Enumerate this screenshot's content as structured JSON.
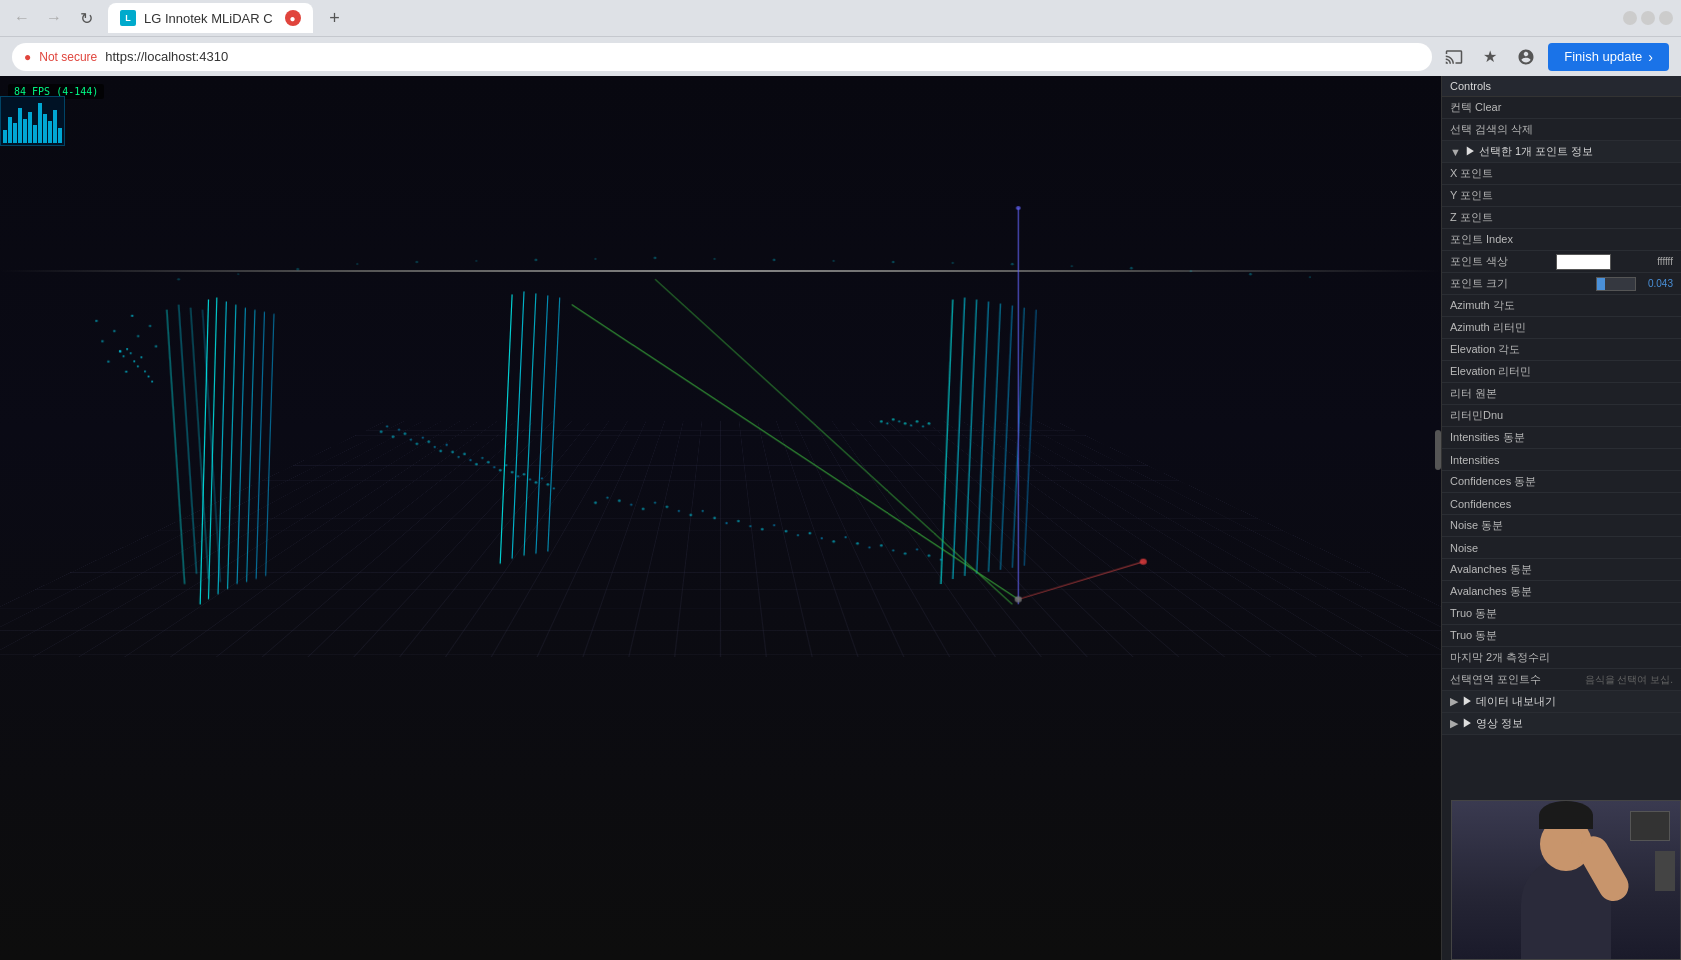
{
  "browser": {
    "tab_title": "LG Innotek MLiDAR C",
    "tab_favicon": "L",
    "new_tab_label": "+",
    "back_disabled": true,
    "forward_disabled": true,
    "refresh_label": "↻",
    "security_label": "Not secure",
    "address": "https://localhost:4310",
    "finish_update_label": "Finish update",
    "window_title": "LG Innotek MLiDAR C",
    "min_btn": "−",
    "max_btn": "□",
    "close_btn": "✕"
  },
  "viewport": {
    "fps_label": "84 FPS (4-144)",
    "waveform_label": "waveform"
  },
  "controls_panel": {
    "title": "Controls",
    "top_buttons": {
      "btn1_label": "컨텍 Clear",
      "btn2_label": "선택 검색의 삭제"
    },
    "selected_point_section": "▶ 선택한 1개 포인트 정보",
    "fields": [
      {
        "label": "X 포인트",
        "value": ""
      },
      {
        "label": "Y 포인트",
        "value": ""
      },
      {
        "label": "Z 포인트",
        "value": ""
      },
      {
        "label": "포인트 Index",
        "value": ""
      },
      {
        "label": "포인트 색상",
        "value": "ffffff",
        "type": "color"
      },
      {
        "label": "포인트 크기",
        "value": "0.043",
        "type": "size"
      },
      {
        "label": "Azimuth 각도",
        "value": ""
      },
      {
        "label": "Azimuth 리터민",
        "value": ""
      },
      {
        "label": "Elevation 각도",
        "value": ""
      },
      {
        "label": "Elevation 리터민",
        "value": ""
      },
      {
        "label": "리터 원본",
        "value": ""
      },
      {
        "label": "리터민Dnu",
        "value": ""
      },
      {
        "label": "Intensities 동분",
        "value": ""
      },
      {
        "label": "Intensities",
        "value": ""
      },
      {
        "label": "Confidences 동분",
        "value": ""
      },
      {
        "label": "Confidences",
        "value": ""
      },
      {
        "label": "Noise 동분",
        "value": ""
      },
      {
        "label": "Noise",
        "value": ""
      },
      {
        "label": "Avalanches 동분",
        "value": ""
      },
      {
        "label": "Avalanches 동분",
        "value": ""
      },
      {
        "label": "Truo 동분",
        "value": ""
      },
      {
        "label": "Truo 동분",
        "value": ""
      },
      {
        "label": "마지막 2개 측정수리",
        "value": ""
      },
      {
        "label": "선택연역 포인트수",
        "value": "음식을 선택여 보십.",
        "type": "placeholder"
      }
    ],
    "data_export_section": "▶ 데이터 내보내기",
    "video_section": "▶ 영상 정보"
  }
}
